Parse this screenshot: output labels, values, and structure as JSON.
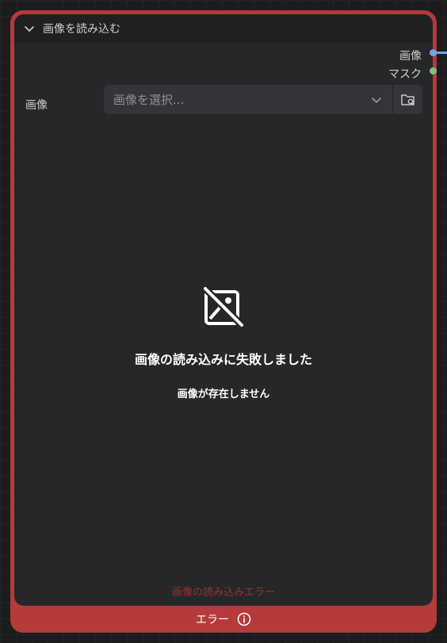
{
  "node": {
    "title": "画像を読み込む",
    "outputs": [
      {
        "label": "画像",
        "color": "#6ea8e0"
      },
      {
        "label": "マスク",
        "color": "#7fc37a"
      }
    ],
    "widget": {
      "label": "画像",
      "placeholder": "画像を選択..."
    },
    "error": {
      "title": "画像の読み込みに失敗しました",
      "subtitle": "画像が存在しません",
      "load_error": "画像の読み込みエラー"
    },
    "footer": {
      "label": "エラー"
    }
  },
  "colors": {
    "error_border": "#b53a3a",
    "node_body": "#262729",
    "header": "#1f2022"
  }
}
